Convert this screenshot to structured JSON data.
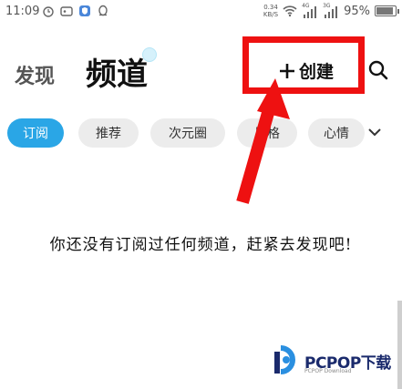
{
  "status_bar": {
    "time": "11:09",
    "net_speed_value": "0.34",
    "net_speed_unit": "KB/S",
    "signal_1": "4G",
    "signal_2": "3G",
    "battery_percent": "95%",
    "battery_level": 0.95
  },
  "header": {
    "tab_discover": "发现",
    "tab_channel": "频道",
    "create_label": "创建"
  },
  "chips": [
    {
      "label": "订阅",
      "active": true
    },
    {
      "label": "推荐",
      "active": false
    },
    {
      "label": "次元圈",
      "active": false
    },
    {
      "label": "风格",
      "active": false
    },
    {
      "label": "心情",
      "active": false
    }
  ],
  "empty_message": "你还没有订阅过任何频道，赶紧去发现吧!",
  "colors": {
    "accent": "#2aa6e6",
    "annotation_red": "#ee1111",
    "chip_bg": "#ececec"
  },
  "watermark": {
    "brand": "PCPOP下载",
    "sub": "PCPOP Download"
  }
}
